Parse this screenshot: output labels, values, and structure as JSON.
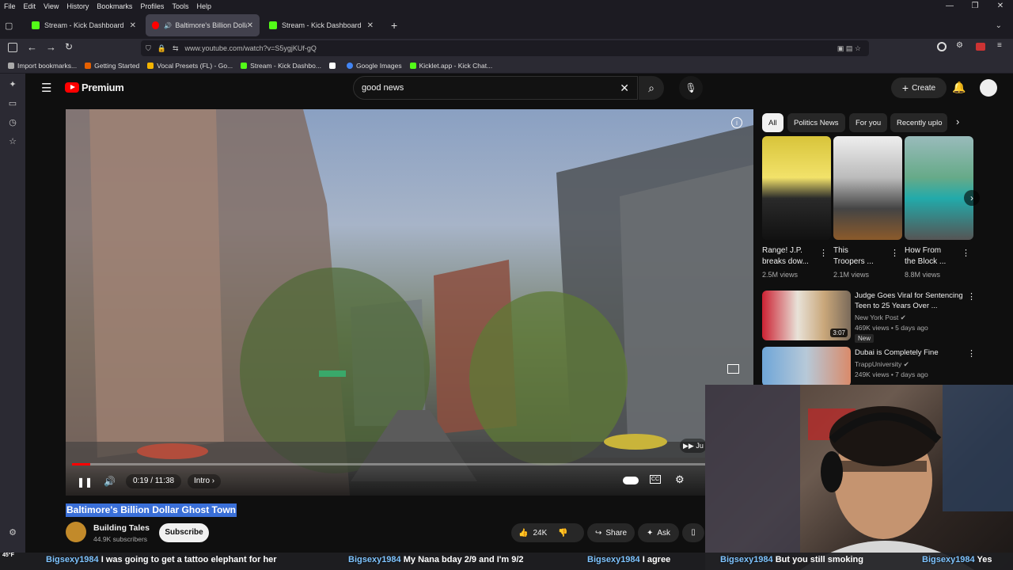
{
  "menu": [
    "File",
    "Edit",
    "View",
    "History",
    "Bookmarks",
    "Profiles",
    "Tools",
    "Help"
  ],
  "window_controls": [
    "—",
    "❐",
    "✕"
  ],
  "tabs": [
    {
      "title": "Stream - Kick Dashboard",
      "fav": "#53fc18"
    },
    {
      "title": "Baltimore's Billion Dollar Gh",
      "fav": "#ff0000"
    },
    {
      "title": "Stream - Kick Dashboard",
      "fav": "#53fc18"
    }
  ],
  "new_tab": "+",
  "url": "www.youtube.com/watch?v=S5ygjKUf-gQ",
  "bookmarks": [
    {
      "label": "Import bookmarks...",
      "color": "#aaa"
    },
    {
      "label": "Getting Started",
      "color": "#e66000"
    },
    {
      "label": "Vocal Presets (FL) - Go...",
      "color": "#f4b400"
    },
    {
      "label": "Stream - Kick Dashbo...",
      "color": "#53fc18"
    },
    {
      "label": "",
      "color": "#fff"
    },
    {
      "label": "Google Images",
      "color": "#4285f4"
    },
    {
      "label": "Kicklet.app - Kick Chat...",
      "color": "#53fc18"
    }
  ],
  "youtube": {
    "logo_text": "Premium",
    "search_value": "good news",
    "create_label": "Create"
  },
  "video": {
    "time": "0:19 / 11:38",
    "chapter": "Intro",
    "progress": 0.027,
    "skip_label": "Ju",
    "title": "Baltimore's Billion Dollar Ghost Town",
    "channel": "Building Tales",
    "subscribers": "44.9K subscribers",
    "subscribe_label": "Subscribe",
    "likes": "24K",
    "share_label": "Share",
    "ask_label": "Ask"
  },
  "chips": [
    "All",
    "Politics News",
    "For you",
    "Recently uplo"
  ],
  "shorts": [
    {
      "title1": "Range! J.P.",
      "title2": "breaks dow...",
      "views": "2.5M views"
    },
    {
      "title1": "This",
      "title2": "Troopers ...",
      "views": "2.1M views"
    },
    {
      "title1": "How From",
      "title2": "the Block ...",
      "views": "8.8M views"
    }
  ],
  "recommended": [
    {
      "title": "Judge Goes Viral for Sentencing Teen to 25 Years Over ...",
      "channel": "New York Post",
      "meta": "469K views • 5 days ago",
      "badge": "New",
      "duration": "3:07"
    },
    {
      "title": "Dubai is Completely Fine",
      "channel": "TrappUniversity",
      "meta": "249K views • 7 days ago"
    }
  ],
  "chat": [
    {
      "user": "Bigsexy1984",
      "msg": "I was going to get a tattoo elephant for her"
    },
    {
      "user": "Bigsexy1984",
      "msg": "My Nana bday 2/9 and I'm 9/2"
    },
    {
      "user": "Bigsexy1984",
      "msg": "I agree"
    },
    {
      "user": "Bigsexy1984",
      "msg": "But you still smoking"
    },
    {
      "user": "Bigsexy1984",
      "msg": "Yes"
    }
  ],
  "weather": "45°F",
  "colors": {
    "accent": "#ff0000",
    "selection": "#3a6fd8",
    "kick": "#53fc18"
  }
}
